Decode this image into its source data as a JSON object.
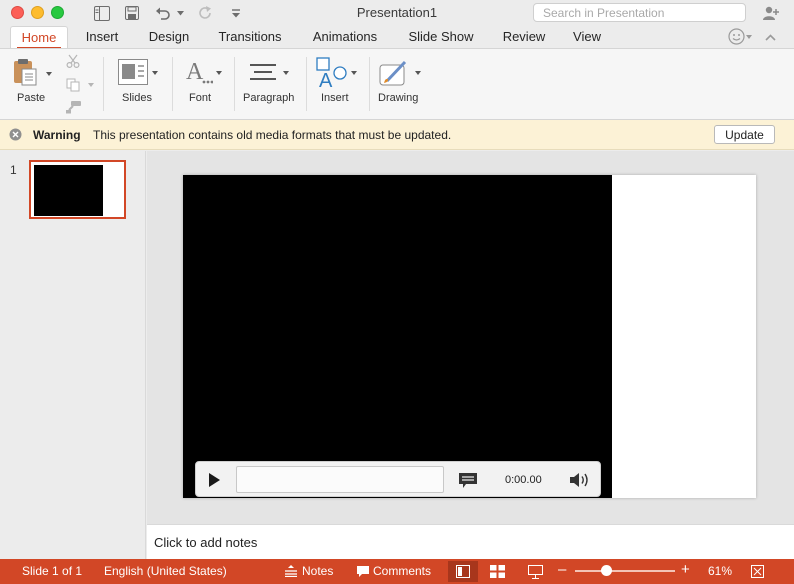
{
  "window": {
    "title": "Presentation1",
    "search_placeholder": "Search in Presentation"
  },
  "tabs": [
    {
      "label": "Home",
      "active": true
    },
    {
      "label": "Insert"
    },
    {
      "label": "Design"
    },
    {
      "label": "Transitions"
    },
    {
      "label": "Animations"
    },
    {
      "label": "Slide Show"
    },
    {
      "label": "Review"
    },
    {
      "label": "View"
    }
  ],
  "ribbon": {
    "paste": "Paste",
    "slides": "Slides",
    "font": "Font",
    "paragraph": "Paragraph",
    "insert": "Insert",
    "drawing": "Drawing"
  },
  "warning": {
    "title": "Warning",
    "message": "This presentation contains old media formats that must be updated.",
    "button": "Update"
  },
  "thumbnails": [
    {
      "number": "1"
    }
  ],
  "player": {
    "time": "0:00.00"
  },
  "notes": {
    "placeholder": "Click to add notes"
  },
  "statusbar": {
    "slide_info": "Slide 1 of 1",
    "language": "English (United States)",
    "notes": "Notes",
    "comments": "Comments",
    "zoom": "61%",
    "zoom_fraction": 0.61
  },
  "colors": {
    "accent": "#d24726",
    "warning_bg": "#fcf2d6"
  }
}
